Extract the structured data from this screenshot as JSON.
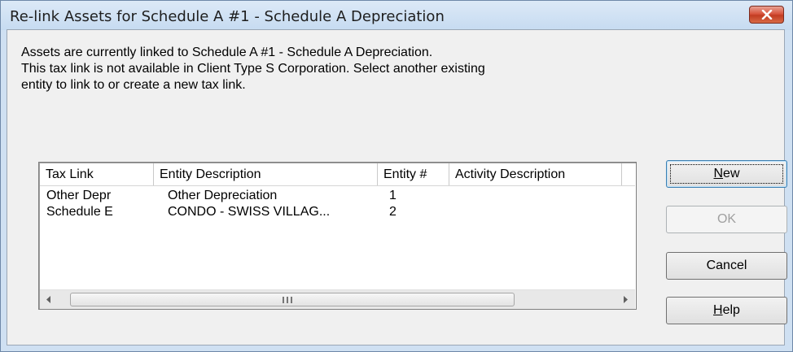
{
  "window": {
    "title": "Re-link Assets for Schedule A #1 - Schedule A Depreciation",
    "close_icon": "close-x-icon"
  },
  "message": {
    "line1": "Assets are currently linked to Schedule A #1 - Schedule A Depreciation.",
    "line2": "This tax link is not available in Client Type S Corporation.  Select another existing",
    "line3": "entity to link to or create a new tax link."
  },
  "list": {
    "columns": [
      "Tax Link",
      "Entity Description",
      "Entity #",
      "Activity Description"
    ],
    "rows": [
      [
        "Other Depr",
        "Other Depreciation",
        "1",
        ""
      ],
      [
        "Schedule E",
        "CONDO - SWISS VILLAG...",
        "2",
        ""
      ]
    ],
    "scroll_left_icon": "arrow-left-icon",
    "scroll_right_icon": "arrow-right-icon"
  },
  "buttons": {
    "new_prefix": "",
    "new_accel": "N",
    "new_rest": "ew",
    "ok": "OK",
    "cancel": "Cancel",
    "help_accel": "H",
    "help_rest": "elp"
  },
  "colors": {
    "title_bar": "#c6dbf1",
    "close_button": "#c23c22",
    "dialog_bg": "#f0f0f0"
  }
}
